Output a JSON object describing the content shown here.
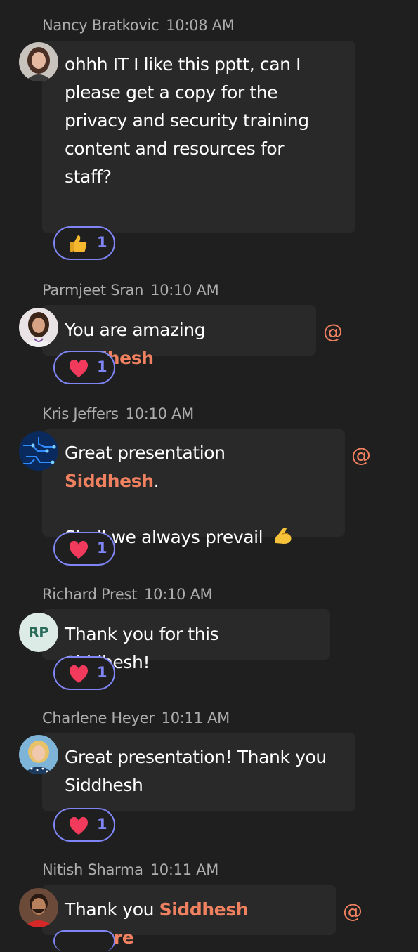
{
  "messages": [
    {
      "author": "Nancy Bratkovic",
      "time": "10:08 AM",
      "avatar": "photo",
      "lines": [
        "ohhh IT I like this pptt, can I",
        "please get a copy for the",
        "privacy and security training",
        "content and resources for",
        "staff?"
      ],
      "reaction": {
        "icon": "thumbs-up-icon",
        "count": "1"
      }
    },
    {
      "author": "Parmjeet Sran",
      "time": "10:10 AM",
      "avatar": "photo",
      "text_before": "You are amazing ",
      "mention": "Siddhesh",
      "text_after": "",
      "at_symbol": "@",
      "reaction": {
        "icon": "heart-icon",
        "count": "1"
      }
    },
    {
      "author": "Kris Jeffers",
      "time": "10:10 AM",
      "avatar": "photo",
      "text_before": "Great presentation ",
      "mention": "Siddhesh",
      "text_after": ".",
      "line2": "Shall we always prevail",
      "line2_emoji": "flexed-biceps-icon",
      "at_symbol": "@",
      "reaction": {
        "icon": "heart-icon",
        "count": "1"
      }
    },
    {
      "author": "Richard Prest",
      "time": "10:10 AM",
      "avatar_initials": "RP",
      "text": "Thank you for this Siddhesh!",
      "reaction": {
        "icon": "heart-icon",
        "count": "1"
      }
    },
    {
      "author": "Charlene Heyer",
      "time": "10:11 AM",
      "avatar": "photo",
      "lines": [
        "Great presentation!  Thank you",
        "Siddhesh"
      ],
      "reaction": {
        "icon": "heart-icon",
        "count": "1"
      }
    },
    {
      "author": "Nitish Sharma",
      "time": "10:11 AM",
      "avatar": "photo",
      "text_before": "Thank you ",
      "mention": "Siddhesh Mhatre",
      "text_after": "",
      "at_symbol": "@"
    }
  ],
  "colors": {
    "background": "#1f1f1f",
    "bubble": "#292929",
    "mention": "#ef8160",
    "reaction_border": "#7f85f5",
    "meta_text": "#adadad"
  }
}
